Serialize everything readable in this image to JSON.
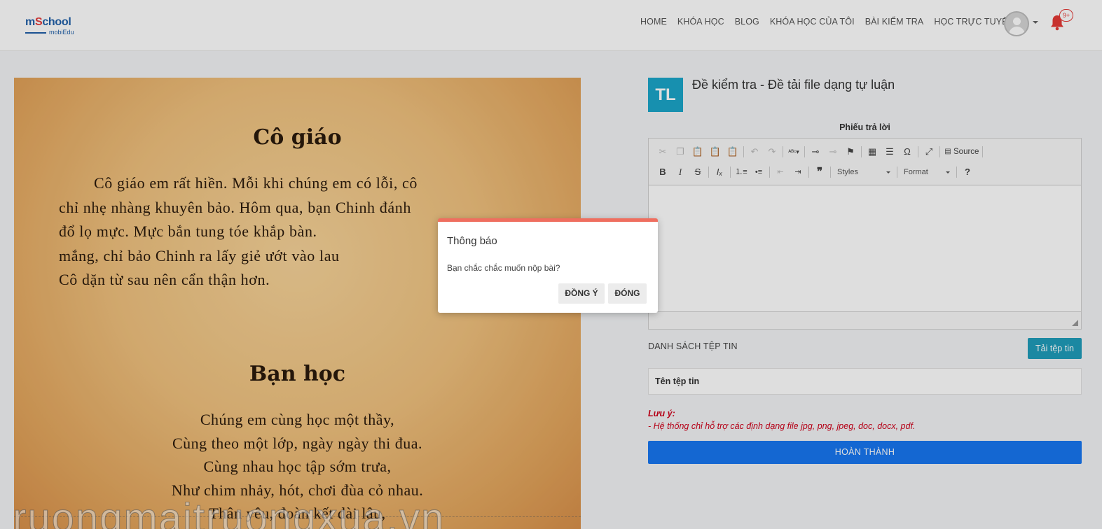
{
  "header": {
    "logo_main_prefix": "m",
    "logo_main_s": "S",
    "logo_main_suffix": "chool",
    "logo_sub": "mobiEdu",
    "nav": [
      "HOME",
      "KHÓA HỌC",
      "BLOG",
      "KHÓA HỌC CỦA TÔI",
      "BÀI KIỂM TRA",
      "HỌC TRỰC TUYẾN"
    ],
    "notification_badge": "9+"
  },
  "image_panel": {
    "title1": "Cô giáo",
    "para1": [
      "Cô giáo em rất hiền. Mỗi khi chúng em có lỗi, cô",
      "chỉ nhẹ nhàng khuyên bảo. Hôm qua, bạn Chinh đánh",
      "đổ lọ mực. Mực bắn tung tóe khắp bàn.",
      "mắng, chỉ bảo Chinh ra lấy giẻ ướt vào lau",
      "Cô dặn từ sau nên cẩn thận hơn."
    ],
    "title2": "Bạn học",
    "poem": [
      "Chúng em cùng học một thầy,",
      "Cùng theo một lớp, ngày ngày thi đua.",
      "Cùng nhau học tập sớm trưa,",
      "Như chim nhảy, hót, chơi đùa cỏ nhau.",
      "Thân yêu, đoàn kết dài lâu,"
    ],
    "watermark": "truongmaitruongxua.vn"
  },
  "exam": {
    "badge": "TL",
    "title": "Đề kiểm tra - Đề tải file dạng tự luận",
    "sheet_label": "Phiếu trả lời"
  },
  "editor": {
    "source_label": "Source",
    "styles_label": "Styles",
    "format_label": "Format"
  },
  "files": {
    "list_label": "DANH SÁCH TỆP TIN",
    "upload_button": "Tải tệp tin",
    "column_name": "Tên tệp tin"
  },
  "note": {
    "title": "Lưu ý:",
    "text": "- Hệ thống chỉ hỗ trợ các định dạng file jpg, png, jpeg, doc, docx, pdf."
  },
  "finish_button": "HOÀN THÀNH",
  "modal": {
    "title": "Thông báo",
    "message": "Bạn chắc chắc muốn nộp bài?",
    "confirm_button": "ĐỒNG Ý",
    "close_button": "ĐÓNG"
  },
  "colors": {
    "accent_blue": "#1877f2",
    "teal": "#1f9dbb",
    "badge_teal": "#1ba6c9",
    "modal_top": "#ef6e5f",
    "note_red": "#d0021b"
  }
}
